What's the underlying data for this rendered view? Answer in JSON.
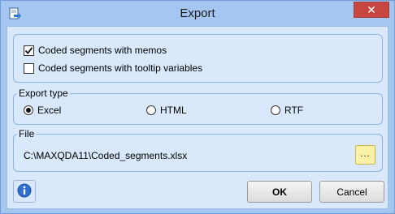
{
  "window": {
    "title": "Export",
    "close_glyph": "✕"
  },
  "options": {
    "memos": {
      "label": "Coded segments with memos",
      "checked": true
    },
    "tooltip": {
      "label": "Coded segments with tooltip variables",
      "checked": false
    }
  },
  "export_type": {
    "legend": "Export type",
    "options": [
      {
        "label": "Excel",
        "checked": true
      },
      {
        "label": "HTML",
        "checked": false
      },
      {
        "label": "RTF",
        "checked": false
      }
    ]
  },
  "file": {
    "legend": "File",
    "path": "C:\\MAXQDA11\\Coded_segments.xlsx",
    "browse_label": "..."
  },
  "buttons": {
    "ok": "OK",
    "cancel": "Cancel"
  },
  "icons": {
    "app": "export-icon",
    "info": "info-icon",
    "close": "close-icon"
  },
  "colors": {
    "title_bar": "#a5c6f0",
    "client": "#d9e8fb",
    "close": "#c7463f",
    "browse": "#fbf1a6"
  }
}
